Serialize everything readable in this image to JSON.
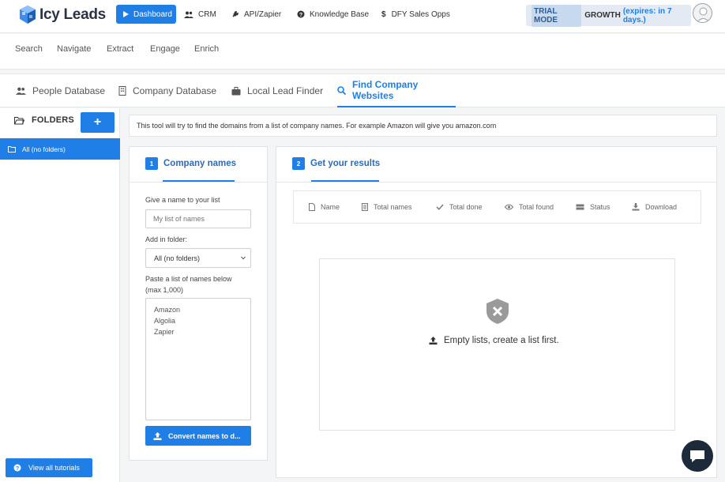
{
  "app": {
    "logo_text": "Icy Leads"
  },
  "topnav": {
    "items": [
      {
        "label": "Dashboard",
        "icon": "play-icon"
      },
      {
        "label": "CRM",
        "icon": "users-icon"
      },
      {
        "label": "API/Zapier",
        "icon": "plug-icon"
      },
      {
        "label": "Knowledge Base",
        "icon": "question-circle-icon"
      },
      {
        "label": "DFY Sales Opps",
        "icon": "dollar-icon"
      }
    ],
    "trial_tag": "TRIAL MODE",
    "plan": "GROWTH",
    "expires": "(expires: in 7 days.)"
  },
  "submenu": {
    "items": [
      "Search",
      "Navigate",
      "Extract",
      "Engage",
      "Enrich"
    ]
  },
  "tabs": [
    {
      "label": "People Database",
      "icon": "users-icon"
    },
    {
      "label": "Company Database",
      "icon": "building-icon"
    },
    {
      "label": "Local Lead Finder",
      "icon": "briefcase-icon"
    },
    {
      "label": "Find Company Websites",
      "icon": "search-icon"
    }
  ],
  "sidebar": {
    "title": "FOLDERS",
    "add_label": "+",
    "folder": "All (no folders)",
    "tutorials": "View all tutorials"
  },
  "info": "This tool will try to find the domains from a list of company names. For example Amazon will give you amazon.com",
  "step1": {
    "num": "1",
    "title": "Company names",
    "name_label": "Give a name to your list",
    "name_placeholder": "My list of names",
    "folder_label": "Add in folder:",
    "folder_value": "All (no folders)",
    "paste_label_1": "Paste a list of names below",
    "paste_label_2": "(max 1,000)",
    "names": [
      "Amazon",
      "Algolia",
      "Zapier"
    ],
    "convert_label": "Convert names to d..."
  },
  "step2": {
    "num": "2",
    "title": "Get your results",
    "columns": [
      "Name",
      "Total names",
      "Total done",
      "Total found",
      "Status",
      "Download"
    ],
    "empty_message": "Empty lists, create a list first."
  },
  "colors": {
    "accent": "#1f7fe6",
    "heading": "#2f6bb3"
  }
}
